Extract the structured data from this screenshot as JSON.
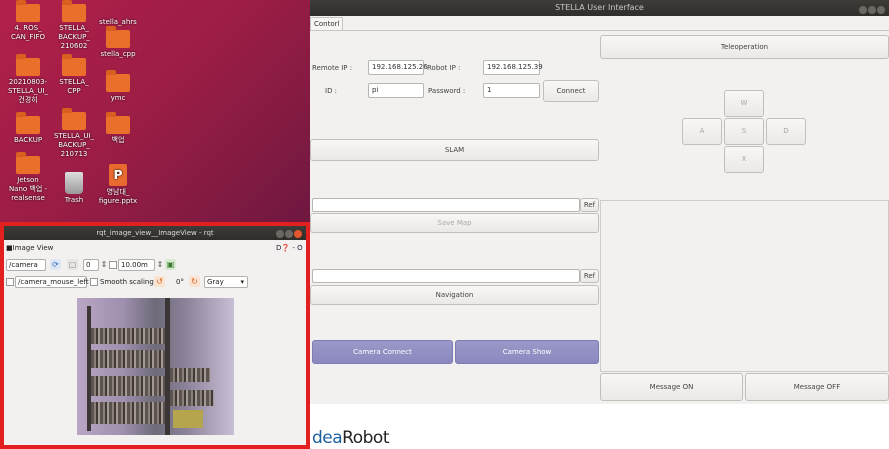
{
  "desktop": {
    "icons": [
      {
        "label": "4. ROS_\nCAN_FIFO",
        "type": "folder"
      },
      {
        "label": "STELLA_\nBACKUP_\n210602",
        "type": "folder"
      },
      {
        "label": "stella_ahrs",
        "type": "folder"
      },
      {
        "label": "20210803-\nSTELLA_UI_\n건경히",
        "type": "folder"
      },
      {
        "label": "STELLA_\nCPP",
        "type": "folder"
      },
      {
        "label": "stella_cpp",
        "type": "folder"
      },
      {
        "label": "ymc",
        "type": "folder"
      },
      {
        "label": "BACKUP",
        "type": "folder"
      },
      {
        "label": "STELLA_UI_\nBACKUP_\n210713",
        "type": "folder"
      },
      {
        "label": "백업",
        "type": "folder"
      },
      {
        "label": "Jetson\nNano 백업 -\nrealsense",
        "type": "folder"
      },
      {
        "label": "Trash",
        "type": "trash"
      },
      {
        "label": "영남대_\nfigure.pptx",
        "type": "pptx"
      }
    ]
  },
  "stella": {
    "title": "STELLA User Interface",
    "tab": "Contorl",
    "remote_ip_label": "Remote IP :",
    "remote_ip_value": "192.168.125.26",
    "robot_ip_label": "Robot IP :",
    "robot_ip_value": "192.168.125.39",
    "id_label": "ID :",
    "id_value": "pi",
    "password_label": "Password :",
    "password_value": "1",
    "connect_label": "Connect",
    "teleoperation_label": "Teleoperation",
    "keys": {
      "w": "W",
      "a": "A",
      "s": "S",
      "d": "D",
      "x": "X"
    },
    "slam_label": "SLAM",
    "ref_label": "Ref",
    "save_map_label": "Save Map",
    "navigation_label": "Navigation",
    "camera_connect_label": "Camera Connect",
    "camera_show_label": "Camera Show",
    "message_on_label": "Message ON",
    "message_off_label": "Message OFF",
    "logo_text_a": "dea",
    "logo_text_b": "Robot"
  },
  "rqt": {
    "title": "rqt_image_view__ImageView - rqt",
    "panel_label": "Image View",
    "help_text": "D❓ - O",
    "topic_value": "/camera",
    "spin_value": "0",
    "distance_value": "10.00m",
    "mouse_topic": "/camera_mouse_left",
    "smooth_label": "Smooth scaling",
    "rotation": "0°",
    "color_mode": "Gray"
  },
  "colors": {
    "highlight_border": "#e2201f",
    "purple_button": "#8a88bf",
    "desktop_bg": "#9a1d45"
  }
}
